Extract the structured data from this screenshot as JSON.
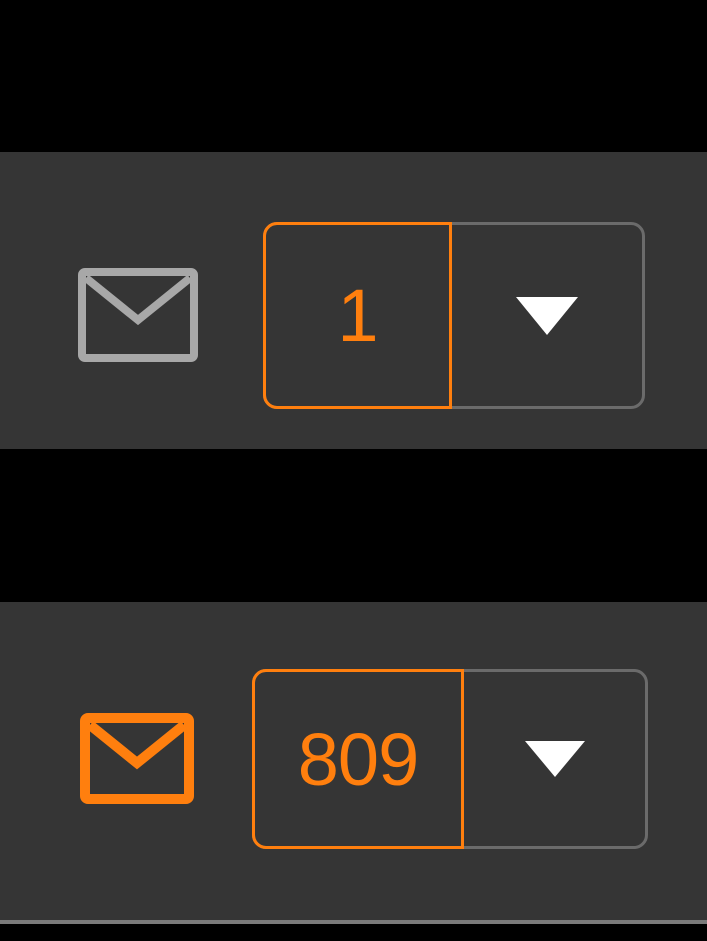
{
  "colors": {
    "background": "#000000",
    "bar": "#353535",
    "accent": "#ff7f0e",
    "inactive_icon": "#a8a8a8",
    "border": "#6b6b6b",
    "arrow": "#ffffff"
  },
  "widgets": [
    {
      "state": "inactive",
      "icon": "envelope-icon",
      "count": "1",
      "dropdown_icon": "triangle-down-icon"
    },
    {
      "state": "active",
      "icon": "envelope-icon",
      "count": "809",
      "dropdown_icon": "triangle-down-icon"
    }
  ]
}
